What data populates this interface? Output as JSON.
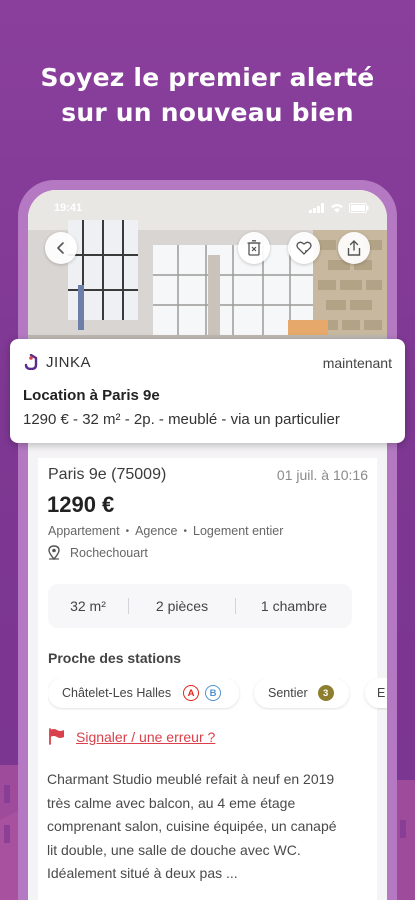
{
  "headline": {
    "line1": "Soyez le premier alerté",
    "line2": "sur un nouveau bien"
  },
  "status_bar": {
    "time": "19:41"
  },
  "notification": {
    "app_name": "JINKA",
    "time": "maintenant",
    "title": "Location à Paris 9e",
    "body": "1290 € - 32 m² - 2p. - meublé - via un particulier"
  },
  "listing": {
    "location": "Paris 9e (75009)",
    "date": "01 juil. à 10:16",
    "price": "1290 €",
    "tags": [
      "Appartement",
      "Agence",
      "Logement entier"
    ],
    "neighborhood": "Rochechouart",
    "specs": [
      "32 m²",
      "2 pièces",
      "1 chambre"
    ],
    "stations_title": "Proche des stations",
    "stations": [
      {
        "name": "Châtelet-Les Halles",
        "lines": [
          "A",
          "B"
        ]
      },
      {
        "name": "Sentier",
        "lines": [
          "3"
        ]
      },
      {
        "name": "E",
        "lines": []
      }
    ],
    "report_link": "Signaler / une erreur ?",
    "description": [
      "Charmant Studio meublé refait à neuf en 2019",
      "très calme avec balcon, au 4 eme étage",
      "comprenant salon, cuisine équipée, un canapé",
      "lit double, une salle de douche avec WC.",
      "Idéalement situé à deux pas ..."
    ]
  },
  "colors": {
    "brand_purple": "#8a3f9c",
    "accent_red": "#d9404b",
    "rer_red": "#e2231a",
    "rer_blue": "#5291ce",
    "metro3_olive": "#8d7f2f"
  },
  "icons": {
    "back": "chevron-left-icon",
    "trash": "trash-icon",
    "favorite": "heart-icon",
    "share": "share-icon",
    "location": "map-pin-icon",
    "report": "flag-icon",
    "app_logo": "jinka-logo-icon"
  }
}
